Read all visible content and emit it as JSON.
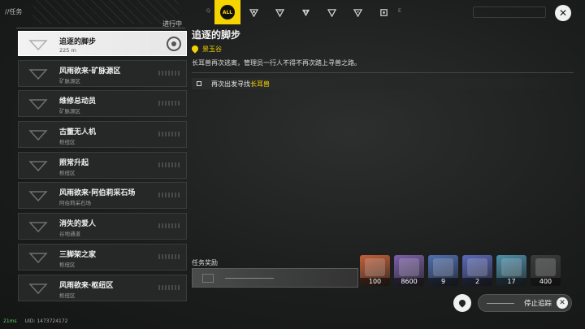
{
  "header": {
    "section_title": "//任务",
    "key_hint_left": "Q",
    "key_hint_right": "E",
    "filter_all_label": "ALL",
    "filter_icons": [
      "all-icon",
      "type-a-icon",
      "type-b-icon",
      "type-c-icon",
      "type-d-icon",
      "type-e-icon",
      "type-f-icon"
    ]
  },
  "list": {
    "progress_tag": "进行中",
    "items": [
      {
        "name": "追逐的脚步",
        "sub": "225 m",
        "active": true
      },
      {
        "name": "风雨欲来·矿脉源区",
        "sub": "矿脉源区"
      },
      {
        "name": "维修总动员",
        "sub": "矿脉源区"
      },
      {
        "name": "古董无人机",
        "sub": "枢纽区"
      },
      {
        "name": "照常升起",
        "sub": "枢纽区"
      },
      {
        "name": "风雨欲来·阿伯莉采石场",
        "sub": "阿伯莉采石场"
      },
      {
        "name": "消失的爱人",
        "sub": "谷地通道"
      },
      {
        "name": "三脚架之家",
        "sub": "枢纽区"
      },
      {
        "name": "风雨欲来·枢纽区",
        "sub": "枢纽区"
      }
    ]
  },
  "detail": {
    "title": "追逐的脚步",
    "location": "景玉谷",
    "description": "长耳兽再次逃离，管理员一行人不得不再次踏上寻兽之路。",
    "objective_prefix": "再次出发寻找",
    "objective_highlight": "长耳兽"
  },
  "rewards": {
    "label": "任务奖励",
    "items": [
      {
        "amount": "100",
        "icon": "red-mech-icon",
        "color": "#c2603a"
      },
      {
        "amount": "8600",
        "icon": "gold-note-icon",
        "color": "#7b5fa8"
      },
      {
        "amount": "9",
        "icon": "blue-crystal-icon",
        "color": "#4f6fb0"
      },
      {
        "amount": "2",
        "icon": "blue-shard-icon",
        "color": "#5b68b8"
      },
      {
        "amount": "17",
        "icon": "green-chip-icon",
        "color": "#4d8faa"
      },
      {
        "amount": "400",
        "icon": "exp-icon",
        "color": "#3a3b3b"
      }
    ]
  },
  "actions": {
    "stop_tracking": "停止追踪"
  },
  "status": {
    "ping": "21ms",
    "uid": "UID: 1473724172"
  },
  "colors": {
    "accent": "#f5d400",
    "panel": "#262727"
  }
}
